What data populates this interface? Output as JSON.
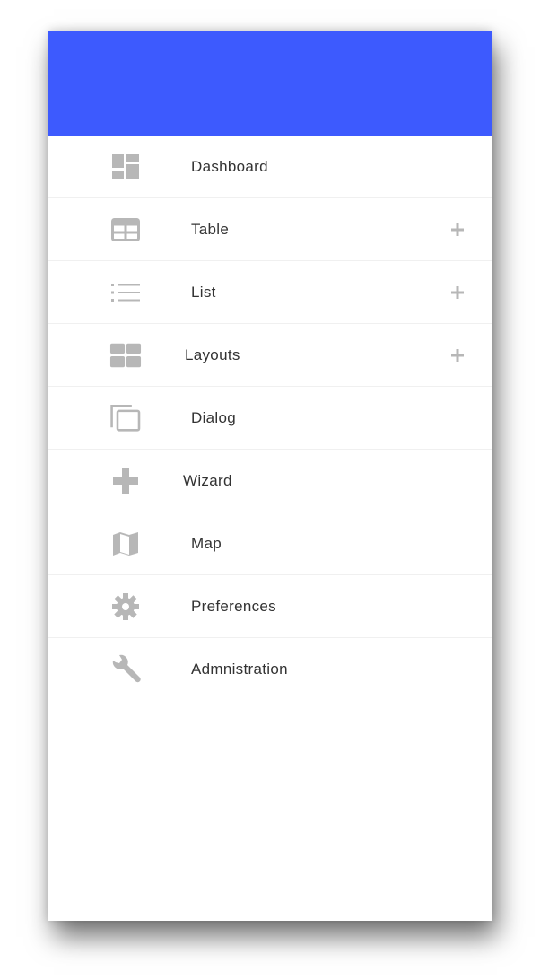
{
  "theme": {
    "header_color": "#3d5afe",
    "icon_color": "#b7b7b7",
    "label_color": "#333333"
  },
  "menu": {
    "items": [
      {
        "label": "Dashboard",
        "icon": "dashboard-icon",
        "expandable": false
      },
      {
        "label": "Table",
        "icon": "table-icon",
        "expandable": true
      },
      {
        "label": "List",
        "icon": "list-icon",
        "expandable": true
      },
      {
        "label": "Layouts",
        "icon": "layouts-icon",
        "expandable": true
      },
      {
        "label": "Dialog",
        "icon": "dialog-icon",
        "expandable": false
      },
      {
        "label": "Wizard",
        "icon": "plus-icon",
        "expandable": false
      },
      {
        "label": "Map",
        "icon": "map-icon",
        "expandable": false
      },
      {
        "label": "Preferences",
        "icon": "gear-icon",
        "expandable": false
      },
      {
        "label": "Admnistration",
        "icon": "wrench-icon",
        "expandable": false
      }
    ]
  }
}
